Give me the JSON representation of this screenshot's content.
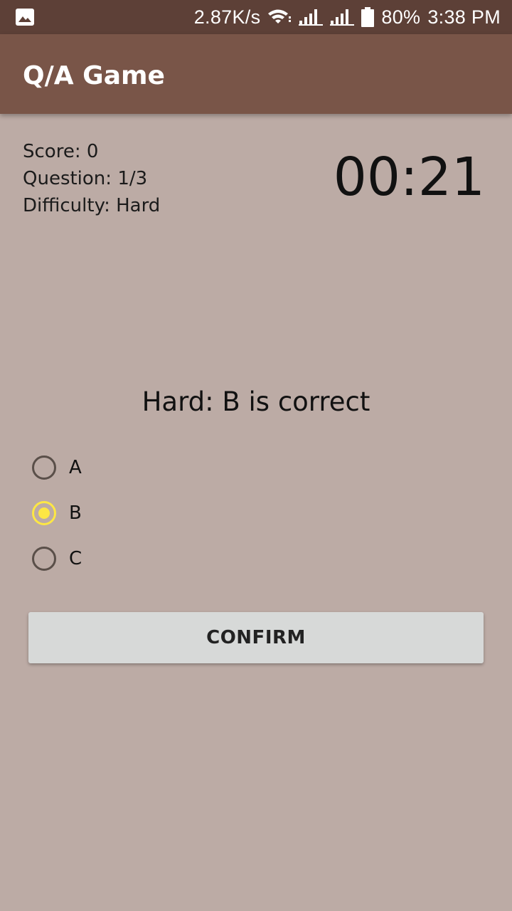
{
  "status_bar": {
    "network_speed": "2.87K/s",
    "battery_percent": "80%",
    "time": "3:38 PM"
  },
  "app_bar": {
    "title": "Q/A Game"
  },
  "info": {
    "score": "Score: 0",
    "question": "Question: 1/3",
    "difficulty": "Difficulty: Hard"
  },
  "timer": "00:21",
  "question_text": "Hard: B is correct",
  "options": [
    {
      "label": "A",
      "selected": false
    },
    {
      "label": "B",
      "selected": true
    },
    {
      "label": "C",
      "selected": false
    }
  ],
  "confirm_label": "CONFIRM",
  "colors": {
    "status_bar": "#5d4037",
    "app_bar": "#795548",
    "background": "#bcaba5",
    "radio_selected": "#fde744",
    "radio_unselected": "#5a4f49",
    "button": "#d7d9d8"
  }
}
